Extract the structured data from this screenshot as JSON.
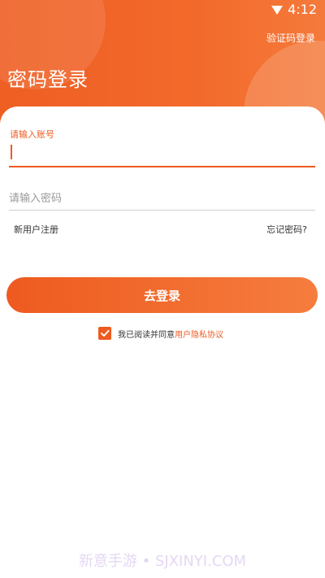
{
  "status_bar": {
    "time": "4:12"
  },
  "header": {
    "switch_link": "验证码登录",
    "title": "密码登录"
  },
  "form": {
    "account_label": "请输入账号",
    "password_placeholder": "请输入密码",
    "register_link": "新用户注册",
    "forgot_link": "忘记密码?",
    "login_button": "去登录"
  },
  "agreement": {
    "checked": true,
    "text": "我已阅读并同意",
    "link": "用户隐私协议"
  },
  "watermark": "新意手游 • SJXINYI.COM",
  "colors": {
    "accent": "#ee5b20",
    "accent_light": "#f57d3e"
  },
  "icons": {
    "wifi": "wifi-icon",
    "check": "check-icon"
  }
}
